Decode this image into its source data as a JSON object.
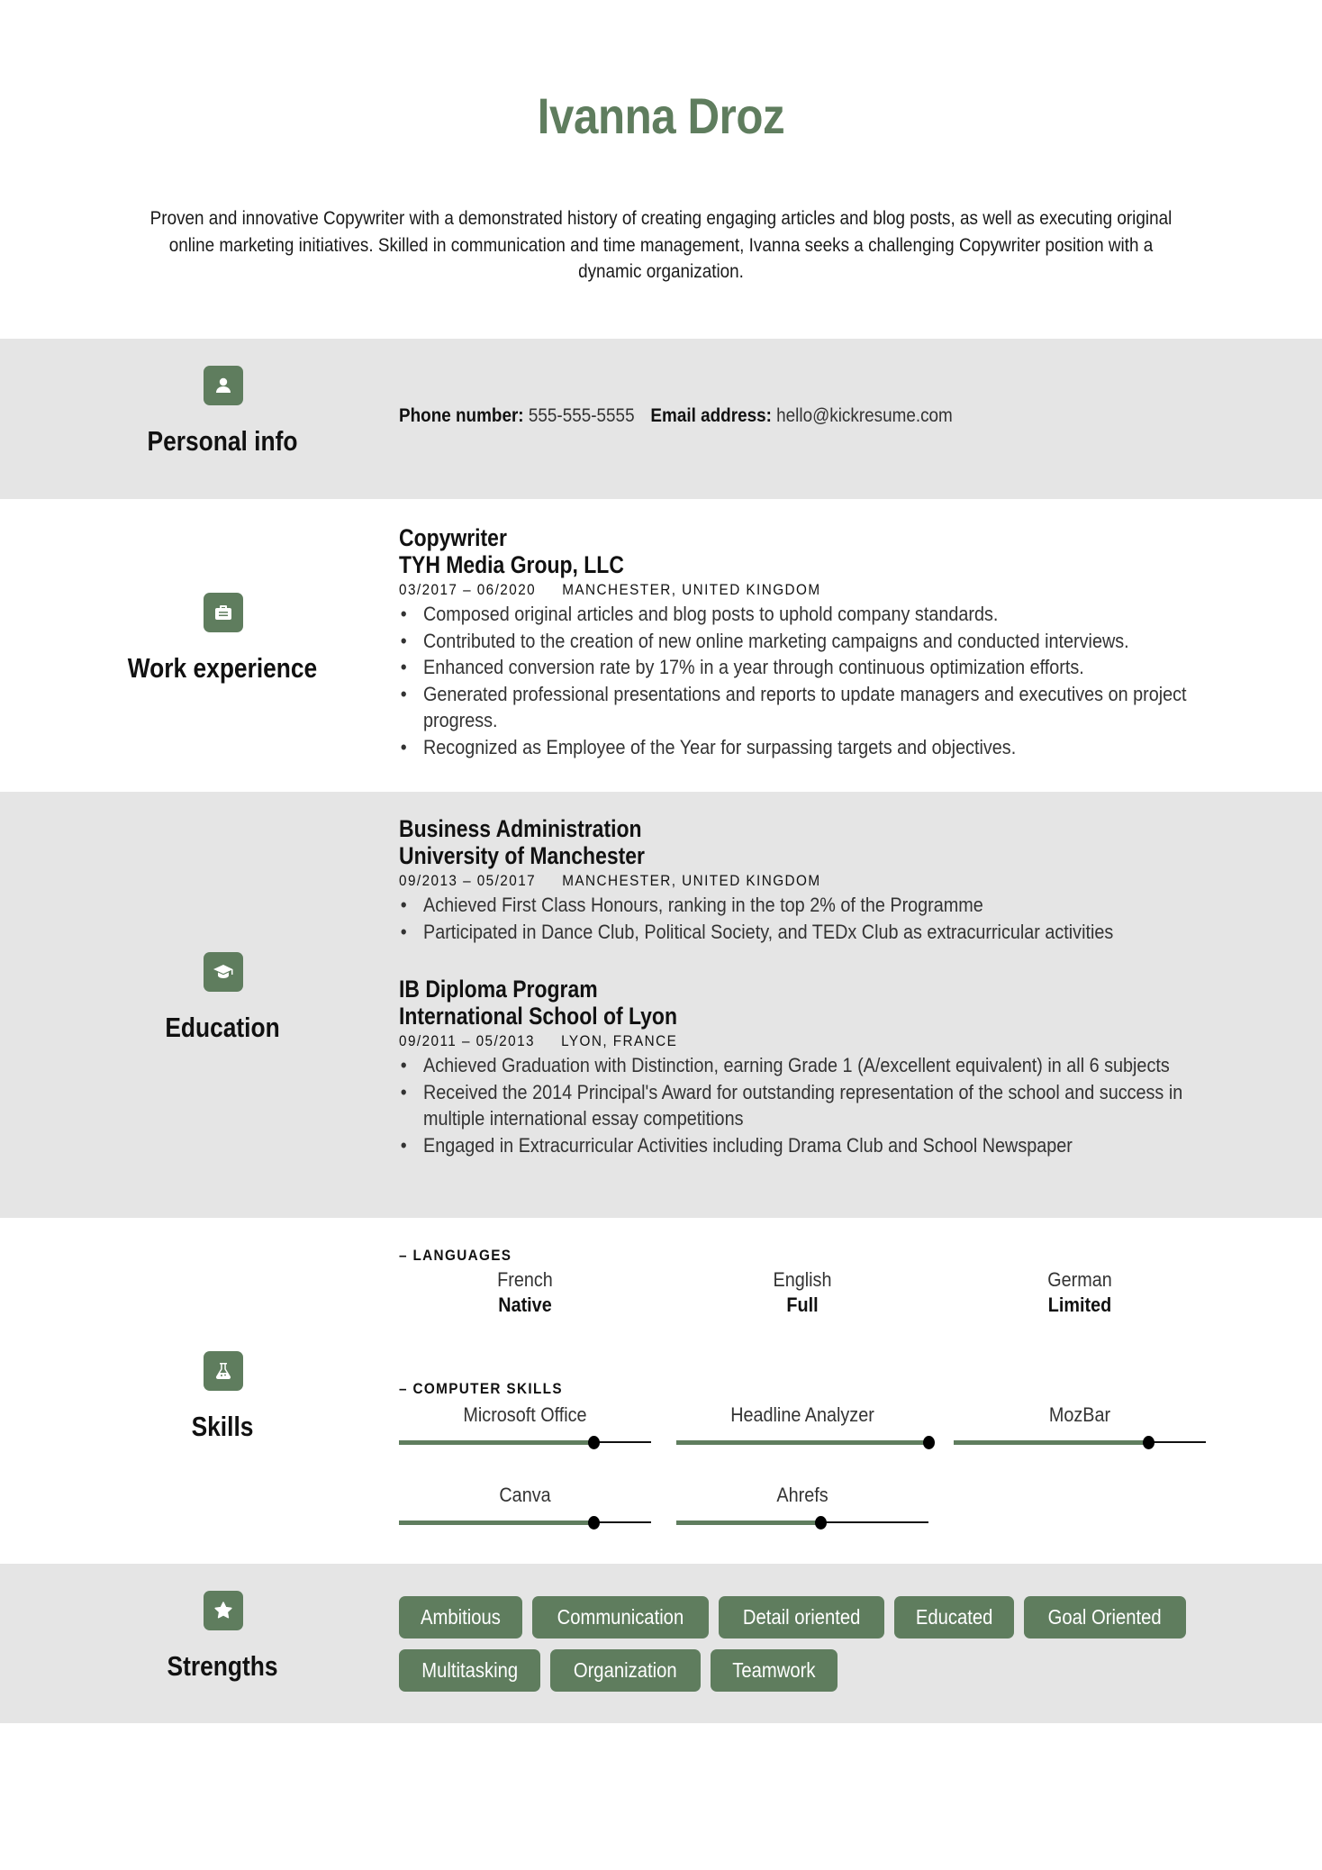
{
  "header": {
    "name": "Ivanna Droz",
    "summary": "Proven and innovative Copywriter with a demonstrated history of creating engaging articles and blog posts, as well as executing original online marketing initiatives. Skilled in communication and time management, Ivanna seeks a challenging Copywriter position with a dynamic organization."
  },
  "colors": {
    "accent": "#5f7d5e",
    "band": "#e5e5e5"
  },
  "personal_info": {
    "title": "Personal info",
    "icon": "user-icon",
    "phone_label": "Phone number:",
    "phone": "555-555-5555",
    "email_label": "Email address:",
    "email": "hello@kickresume.com"
  },
  "work_experience": {
    "title": "Work experience",
    "icon": "briefcase-icon",
    "entries": [
      {
        "role": "Copywriter",
        "company": "TYH Media Group, LLC",
        "dates": "03/2017 – 06/2020",
        "location": "MANCHESTER, UNITED KINGDOM",
        "bullets": [
          "Composed original articles and blog posts to uphold company standards.",
          "Contributed to the creation of new online marketing campaigns and conducted interviews.",
          "Enhanced conversion rate by 17% in a year through continuous optimization efforts.",
          "Generated professional presentations and reports to update managers and executives on project progress.",
          "Recognized as Employee of the Year for surpassing targets and objectives."
        ]
      }
    ]
  },
  "education": {
    "title": "Education",
    "icon": "graduation-cap-icon",
    "entries": [
      {
        "degree": "Business Administration",
        "school": "University of Manchester",
        "dates": "09/2013 – 05/2017",
        "location": "MANCHESTER, UNITED KINGDOM",
        "bullets": [
          "Achieved First Class Honours, ranking in the top 2% of the Programme",
          "Participated in Dance Club, Political Society, and TEDx Club as extracurricular activities"
        ]
      },
      {
        "degree": "IB Diploma Program",
        "school": "International School of Lyon",
        "dates": "09/2011 – 05/2013",
        "location": "LYON, FRANCE",
        "bullets": [
          "Achieved Graduation with Distinction, earning Grade 1 (A/excellent equivalent) in all 6 subjects",
          "Received the 2014 Principal's Award for outstanding representation of the school and success in multiple international essay competitions",
          "Engaged in Extracurricular Activities including Drama Club and School Newspaper"
        ]
      }
    ]
  },
  "skills": {
    "title": "Skills",
    "icon": "flask-icon",
    "languages_heading": "– LANGUAGES",
    "languages": [
      {
        "name": "French",
        "level": "Native"
      },
      {
        "name": "English",
        "level": "Full"
      },
      {
        "name": "German",
        "level": "Limited"
      }
    ],
    "computer_heading": "– COMPUTER SKILLS",
    "computer_skills": [
      {
        "name": "Microsoft Office",
        "level": 0.77
      },
      {
        "name": "Headline Analyzer",
        "level": 1.0
      },
      {
        "name": "MozBar",
        "level": 0.77
      },
      {
        "name": "Canva",
        "level": 0.77
      },
      {
        "name": "Ahrefs",
        "level": 0.57
      }
    ]
  },
  "strengths": {
    "title": "Strengths",
    "icon": "star-icon",
    "tags": [
      "Ambitious",
      "Communication",
      "Detail oriented",
      "Educated",
      "Goal Oriented",
      "Multitasking",
      "Organization",
      "Teamwork"
    ]
  }
}
